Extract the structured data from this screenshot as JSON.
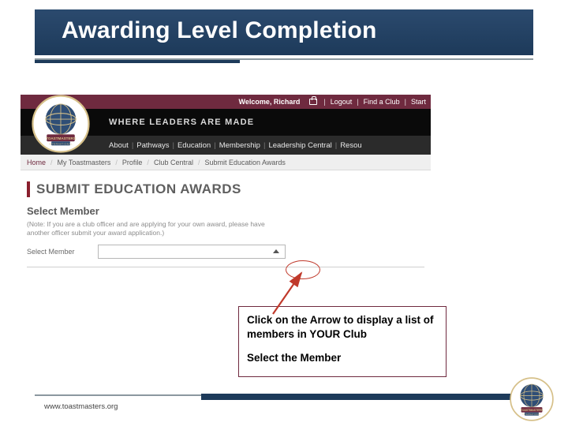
{
  "title": "Awarding Level Completion",
  "ribbon": {
    "welcome": "Welcome, Richard",
    "logout": "Logout",
    "find_club": "Find a Club",
    "start": "Start"
  },
  "tagline": "WHERE LEADERS ARE MADE",
  "nav": {
    "items": [
      "About",
      "Pathways",
      "Education",
      "Membership",
      "Leadership Central",
      "Resou"
    ]
  },
  "crumbs": {
    "items": [
      "Home",
      "My Toastmasters",
      "Profile",
      "Club Central",
      "Submit Education Awards"
    ]
  },
  "page": {
    "heading": "SUBMIT EDUCATION AWARDS",
    "subhead": "Select Member",
    "note": "(Note: If you are a club officer and are applying for your own award, please have another officer submit your award application.)",
    "field_label": "Select Member"
  },
  "callout": {
    "line1": "Click on the Arrow to display a list of members in YOUR Club",
    "line2": "Select the Member"
  },
  "footer": {
    "url": "www.toastmasters.org"
  }
}
